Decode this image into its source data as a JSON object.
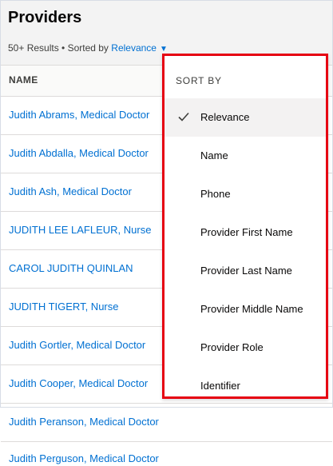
{
  "header": {
    "title": "Providers",
    "results": "50+ Results • Sorted by",
    "sort_value": "Relevance",
    "caret": "▼"
  },
  "table": {
    "column": "NAME",
    "rows": [
      "Judith Abrams, Medical Doctor",
      "Judith Abdalla, Medical Doctor",
      "Judith Ash, Medical Doctor",
      "JUDITH LEE LAFLEUR, Nurse",
      "CAROL JUDITH QUINLAN",
      "JUDITH TIGERT, Nurse",
      "Judith Gortler, Medical Doctor",
      "Judith Cooper, Medical Doctor",
      "Judith Peranson, Medical Doctor",
      "Judith Perguson, Medical Doctor"
    ]
  },
  "dropdown": {
    "title": "SORT BY",
    "selected_index": 0,
    "options": [
      "Relevance",
      "Name",
      "Phone",
      "Provider First Name",
      "Provider Last Name",
      "Provider Middle Name",
      "Provider Role",
      "Identifier"
    ]
  },
  "colors": {
    "link": "#0070d2",
    "highlight_border": "#e60012",
    "selected_bg": "#f3f2f2"
  }
}
